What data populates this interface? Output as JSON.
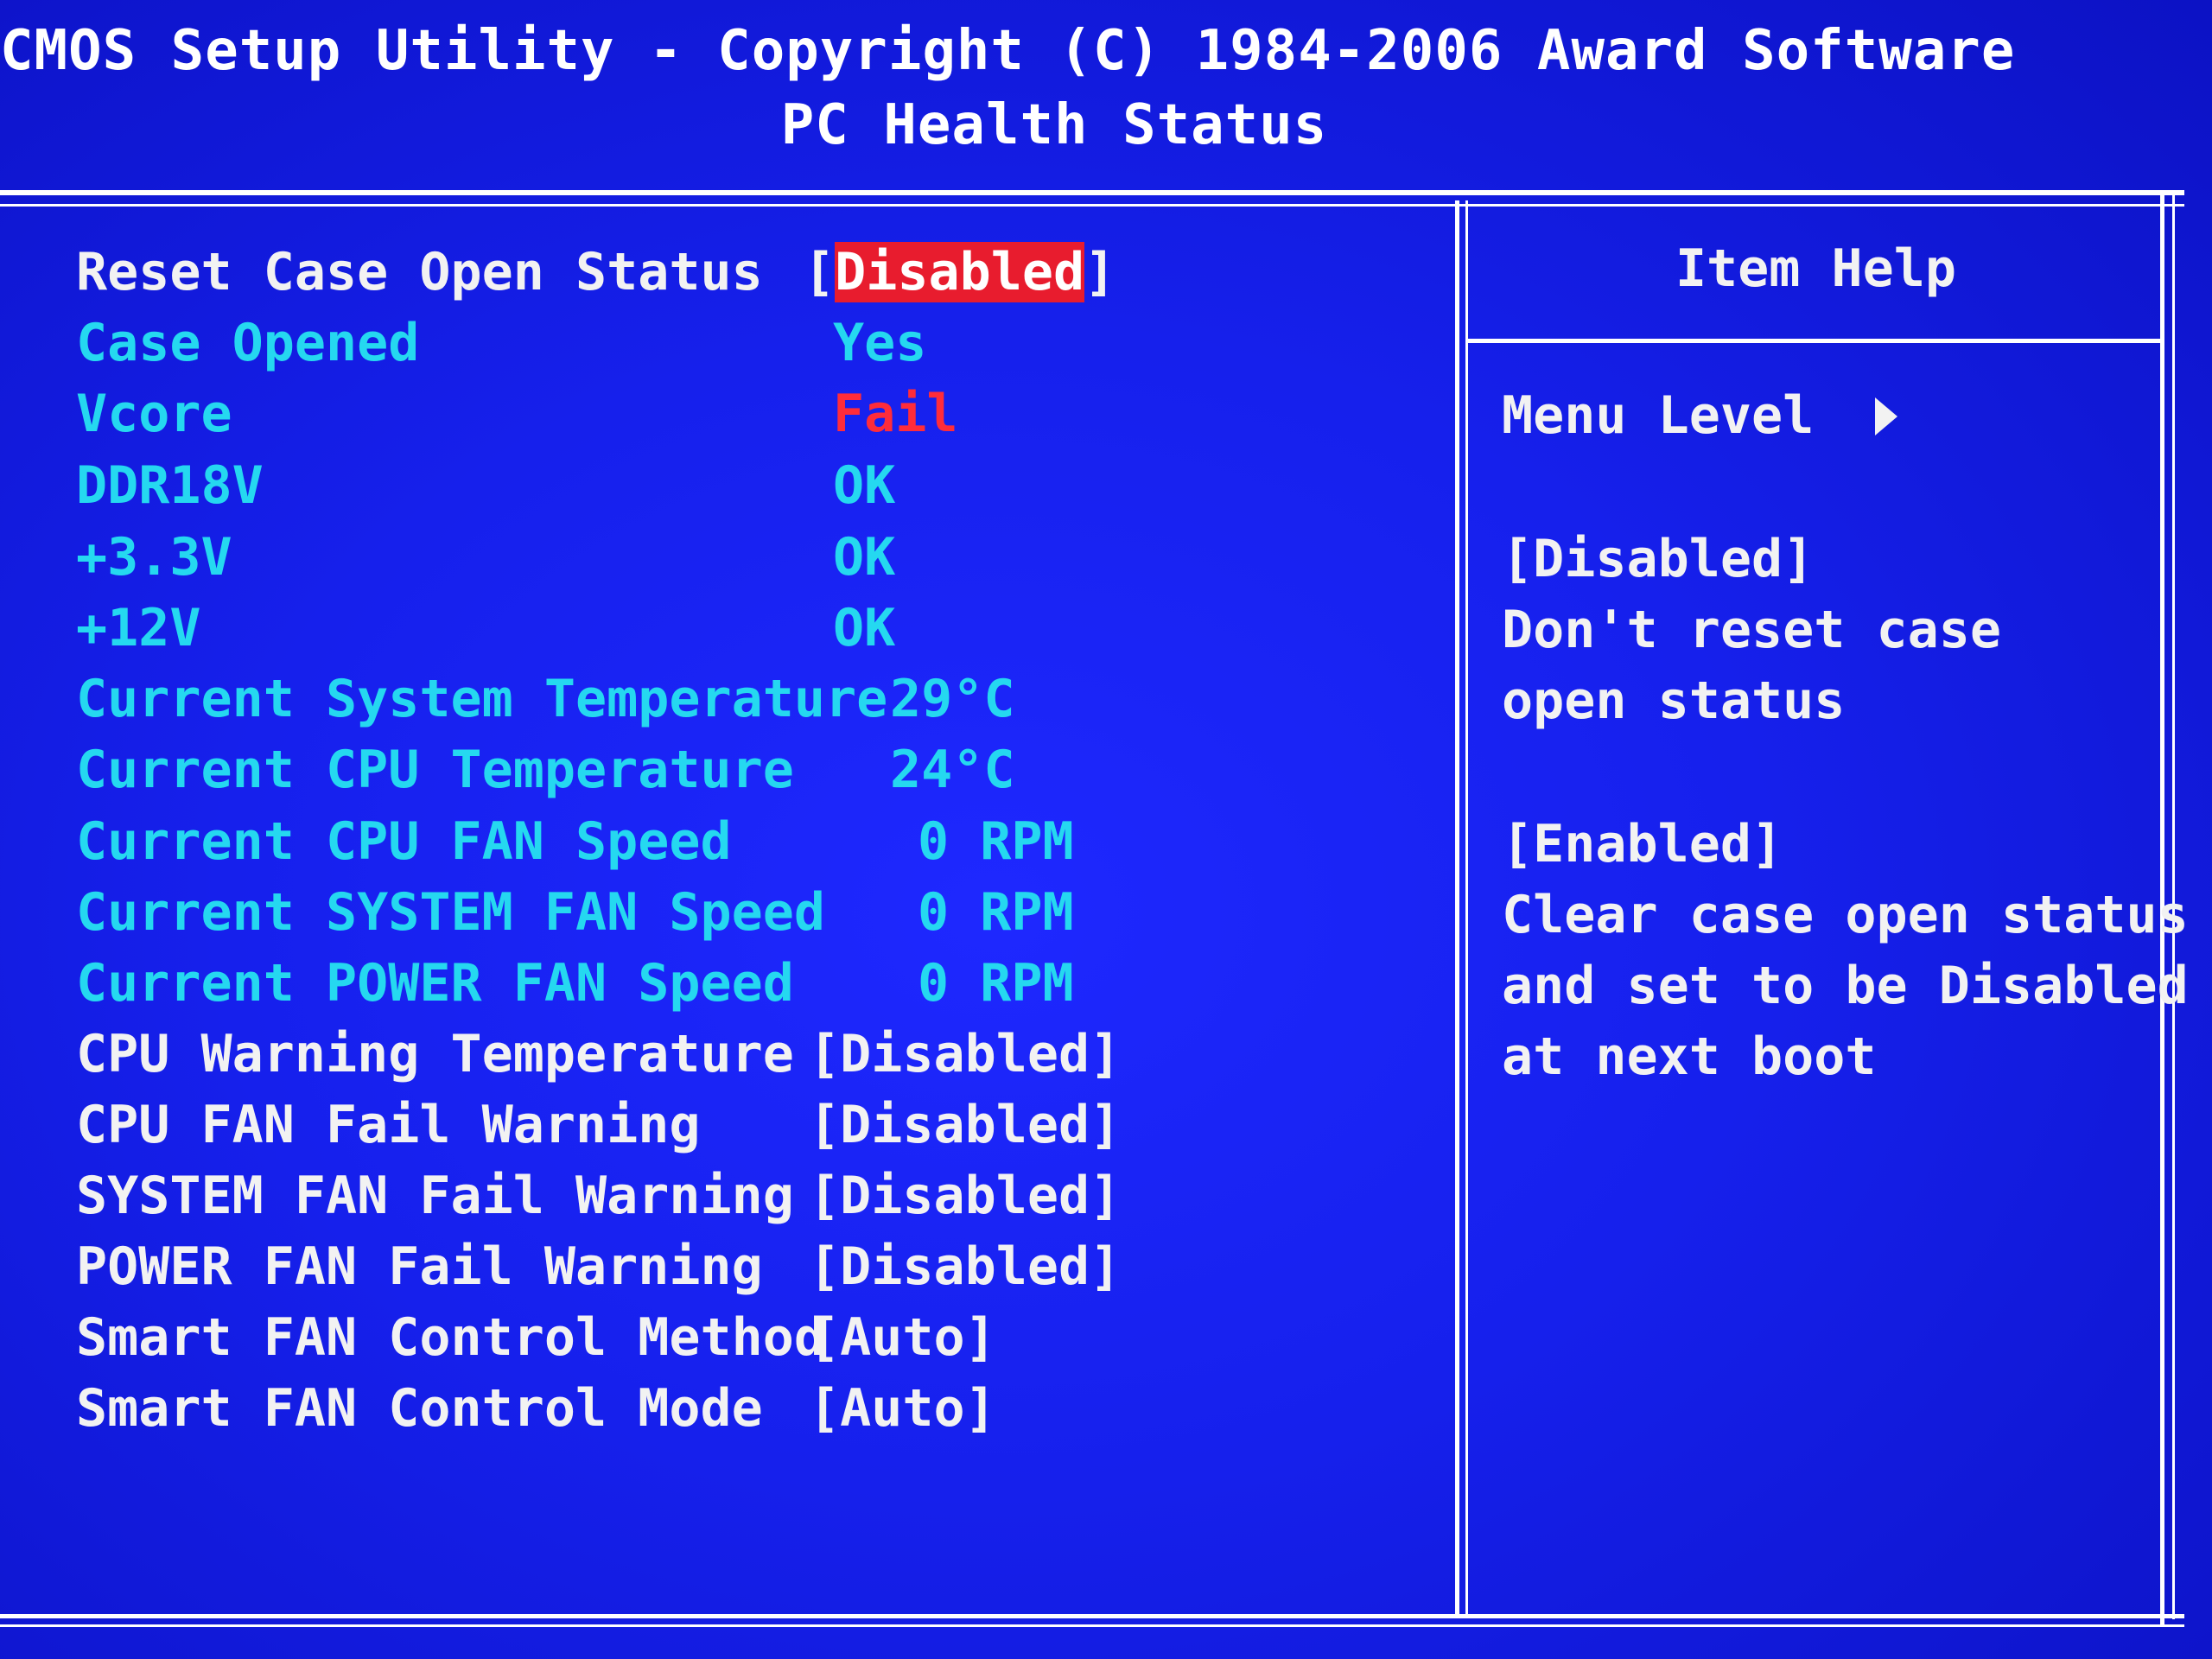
{
  "header": {
    "title": "CMOS Setup Utility - Copyright (C) 1984-2006 Award Software",
    "subtitle": "PC Health Status"
  },
  "items": [
    {
      "label": "Reset Case Open Status",
      "value_prefix": "[",
      "value": "Disabled",
      "value_suffix": "]"
    },
    {
      "label": "Case Opened",
      "value": "Yes"
    },
    {
      "label": "Vcore",
      "value": "Fail"
    },
    {
      "label": "DDR18V",
      "value": "OK"
    },
    {
      "label": "+3.3V",
      "value": "OK"
    },
    {
      "label": "+12V",
      "value": "OK"
    },
    {
      "label": "Current System Temperature",
      "value": "29°C"
    },
    {
      "label": "Current CPU Temperature",
      "value": "24°C"
    },
    {
      "label": "Current CPU FAN Speed",
      "value": "0 RPM"
    },
    {
      "label": "Current SYSTEM FAN Speed",
      "value": "0 RPM"
    },
    {
      "label": "Current POWER FAN Speed",
      "value": "0 RPM"
    },
    {
      "label": "CPU Warning Temperature",
      "value": "[Disabled]"
    },
    {
      "label": "CPU FAN Fail Warning",
      "value": "[Disabled]"
    },
    {
      "label": "SYSTEM FAN Fail Warning",
      "value": "[Disabled]"
    },
    {
      "label": "POWER FAN Fail Warning",
      "value": "[Disabled]"
    },
    {
      "label": "Smart FAN Control Method",
      "value": "[Auto]"
    },
    {
      "label": "Smart FAN Control Mode",
      "value": "[Auto]"
    }
  ],
  "help": {
    "title": "Item Help",
    "menu_level": "Menu Level",
    "lines": [
      "[Disabled]",
      "Don't reset case",
      "open status",
      "[Enabled]",
      "Clear case open status",
      "and set to be Disabled",
      "at next boot"
    ]
  },
  "colors": {
    "background": "#1620ec",
    "label_active": "#f2f2f2",
    "label_readonly": "#25d8f0",
    "fail": "#ff2c3a",
    "highlight": "#e81c2e"
  }
}
